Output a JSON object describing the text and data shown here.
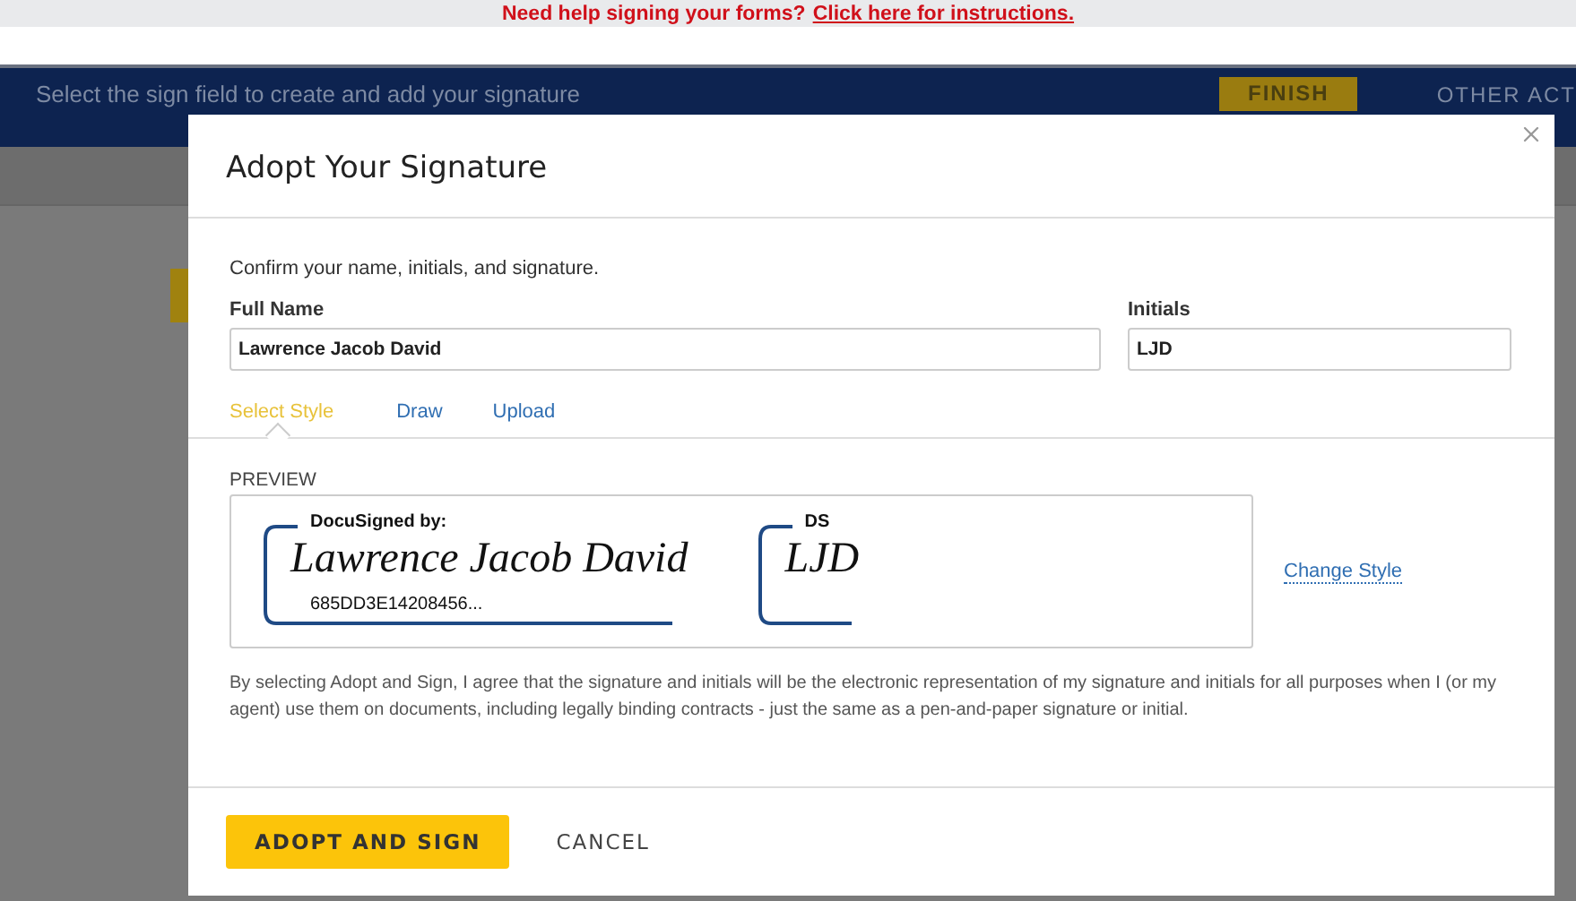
{
  "help_banner": {
    "text": "Need help signing your forms?",
    "link": "Click here for instructions."
  },
  "action_bar": {
    "message": "Select the sign field to create and add your signature",
    "finish": "FINISH",
    "other": "OTHER ACT"
  },
  "dialog": {
    "title": "Adopt Your Signature",
    "intro": "Confirm your name, initials, and signature.",
    "full_name": {
      "label": "Full Name",
      "value": "Lawrence Jacob David"
    },
    "initials": {
      "label": "Initials",
      "value": "LJD"
    },
    "tabs": [
      {
        "label": "Select Style",
        "selected": true
      },
      {
        "label": "Draw",
        "selected": false
      },
      {
        "label": "Upload",
        "selected": false
      }
    ],
    "preview": {
      "label": "PREVIEW",
      "signature": {
        "header": "DocuSigned by:",
        "name": "Lawrence Jacob David",
        "id": "685DD3E14208456..."
      },
      "initials": {
        "header": "DS",
        "value": "LJD"
      },
      "change_style": "Change Style"
    },
    "legal": "By selecting Adopt and Sign, I agree that the signature and initials will be the electronic representation of my signature and initials for all purposes when I (or my agent) use them on documents, including legally binding contracts - just the same as a pen-and-paper signature or initial.",
    "buttons": {
      "adopt": "ADOPT AND SIGN",
      "cancel": "CANCEL"
    }
  }
}
